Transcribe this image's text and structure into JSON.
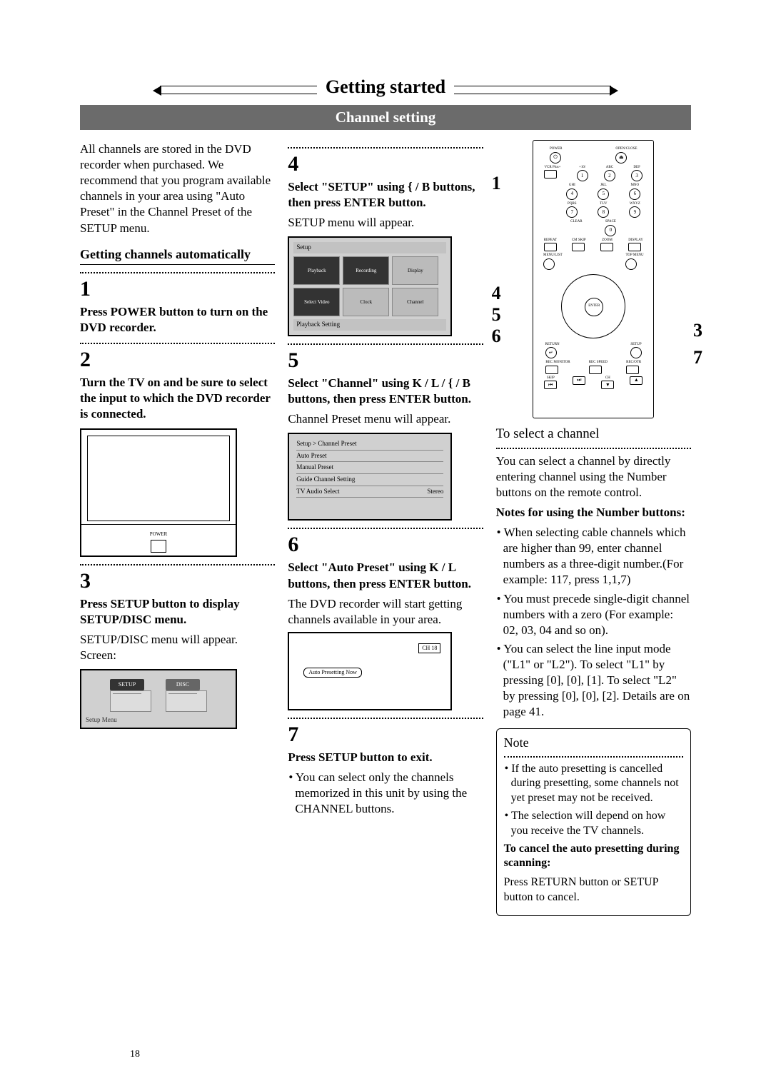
{
  "page_title": "Getting started",
  "section_bar": "Channel setting",
  "intro_para": "All channels are stored in the DVD recorder when purchased. We recommend that you program available channels in your area using \"Auto Preset\" in the Channel Preset of the SETUP menu.",
  "sub_heading": "Getting channels automatically",
  "step1": {
    "num": "1",
    "bold": "Press POWER button to turn on the DVD recorder."
  },
  "step2": {
    "num": "2",
    "bold": "Turn the TV on and be sure to select the input to which the DVD recorder is connected."
  },
  "tv_power_label": "POWER",
  "step3": {
    "num": "3",
    "bold": "Press SETUP button to display SETUP/DISC menu.",
    "plain": "SETUP/DISC menu will appear. Screen:"
  },
  "setup_screen": {
    "btn1": "SETUP",
    "btn2": "DISC",
    "caption": "Setup Menu"
  },
  "step4": {
    "num": "4",
    "bold": "Select \"SETUP\" using { / B buttons, then press ENTER button.",
    "plain": "SETUP menu will appear."
  },
  "menu_screen": {
    "header": "Setup",
    "c1": "Playback",
    "c2": "Recording",
    "c3": "Display",
    "c4": "Select Video",
    "c5": "Clock",
    "c6": "Channel",
    "footer": "Playback Setting"
  },
  "step5": {
    "num": "5",
    "bold": "Select \"Channel\" using K / L / { / B buttons, then press ENTER button.",
    "plain": "Channel Preset menu will appear."
  },
  "preset_screen": {
    "header": "Setup > Channel Preset",
    "r1": "Auto Preset",
    "r2": "Manual Preset",
    "r3": "Guide Channel Setting",
    "r4a": "TV Audio Select",
    "r4b": "Stereo"
  },
  "step6": {
    "num": "6",
    "bold": "Select \"Auto Preset\" using K / L buttons, then press ENTER button.",
    "plain": "The DVD recorder will start getting channels available in your area."
  },
  "auto_screen": {
    "ch": "CH 18",
    "now": "Auto Presetting Now"
  },
  "step7": {
    "num": "7",
    "bold": "Press SETUP button to exit.",
    "bullet": "You can select only the channels memorized in this unit by using the CHANNEL buttons."
  },
  "callouts": {
    "c1": "1",
    "c4": "4",
    "c5": "5",
    "c6": "6",
    "c3": "3",
    "c7": "7"
  },
  "select_channel": {
    "heading": "To select a channel",
    "para": "You can select a channel by directly entering channel using the Number buttons on the remote control.",
    "notes_h": "Notes for using the Number buttons:",
    "b1": "When selecting cable channels which are higher than 99, enter channel numbers as a three-digit number.(For example: 117, press 1,1,7)",
    "b2": "You must precede single-digit channel numbers with a zero (For example: 02, 03, 04 and so on).",
    "b3": "You can select the line input mode (\"L1\" or \"L2\"). To select \"L1\" by pressing [0], [0], [1]. To select \"L2\" by pressing [0], [0], [2]. Details are on page 41."
  },
  "note_box": {
    "title": "Note",
    "b1": "If the auto presetting is cancelled during presetting, some channels not yet preset may not be received.",
    "b2": "The selection will depend on how you receive the TV channels.",
    "cancel_h": "To cancel the auto presetting during scanning:",
    "cancel_p": "Press RETURN button or SETUP button to cancel."
  },
  "remote_labels": {
    "power": "POWER",
    "open": "OPEN/CLOSE",
    "vcrplus": "VCR Plus+",
    "abc": "ABC",
    "def": "DEF",
    "ghi": "GHI",
    "jkl": "JKL",
    "mno": "MNO",
    "pqrs": "PQRS",
    "tuv": "TUV",
    "wxyz": "WXYZ",
    "clear": "CLEAR",
    "space": "SPACE",
    "repeat": "REPEAT",
    "cmskip": "CM SKIP",
    "zoom": "ZOOM",
    "display": "DISPLAY",
    "menulist": "MENU/LIST",
    "topmenu": "TOP MENU",
    "enter": "ENTER",
    "return": "RETURN",
    "setup": "SETUP",
    "recmon": "REC MONITOR",
    "recspd": "REC SPEED",
    "recotr": "REC/OTR",
    "skip": "SKIP",
    "ch": "CH"
  },
  "page_number": "18"
}
